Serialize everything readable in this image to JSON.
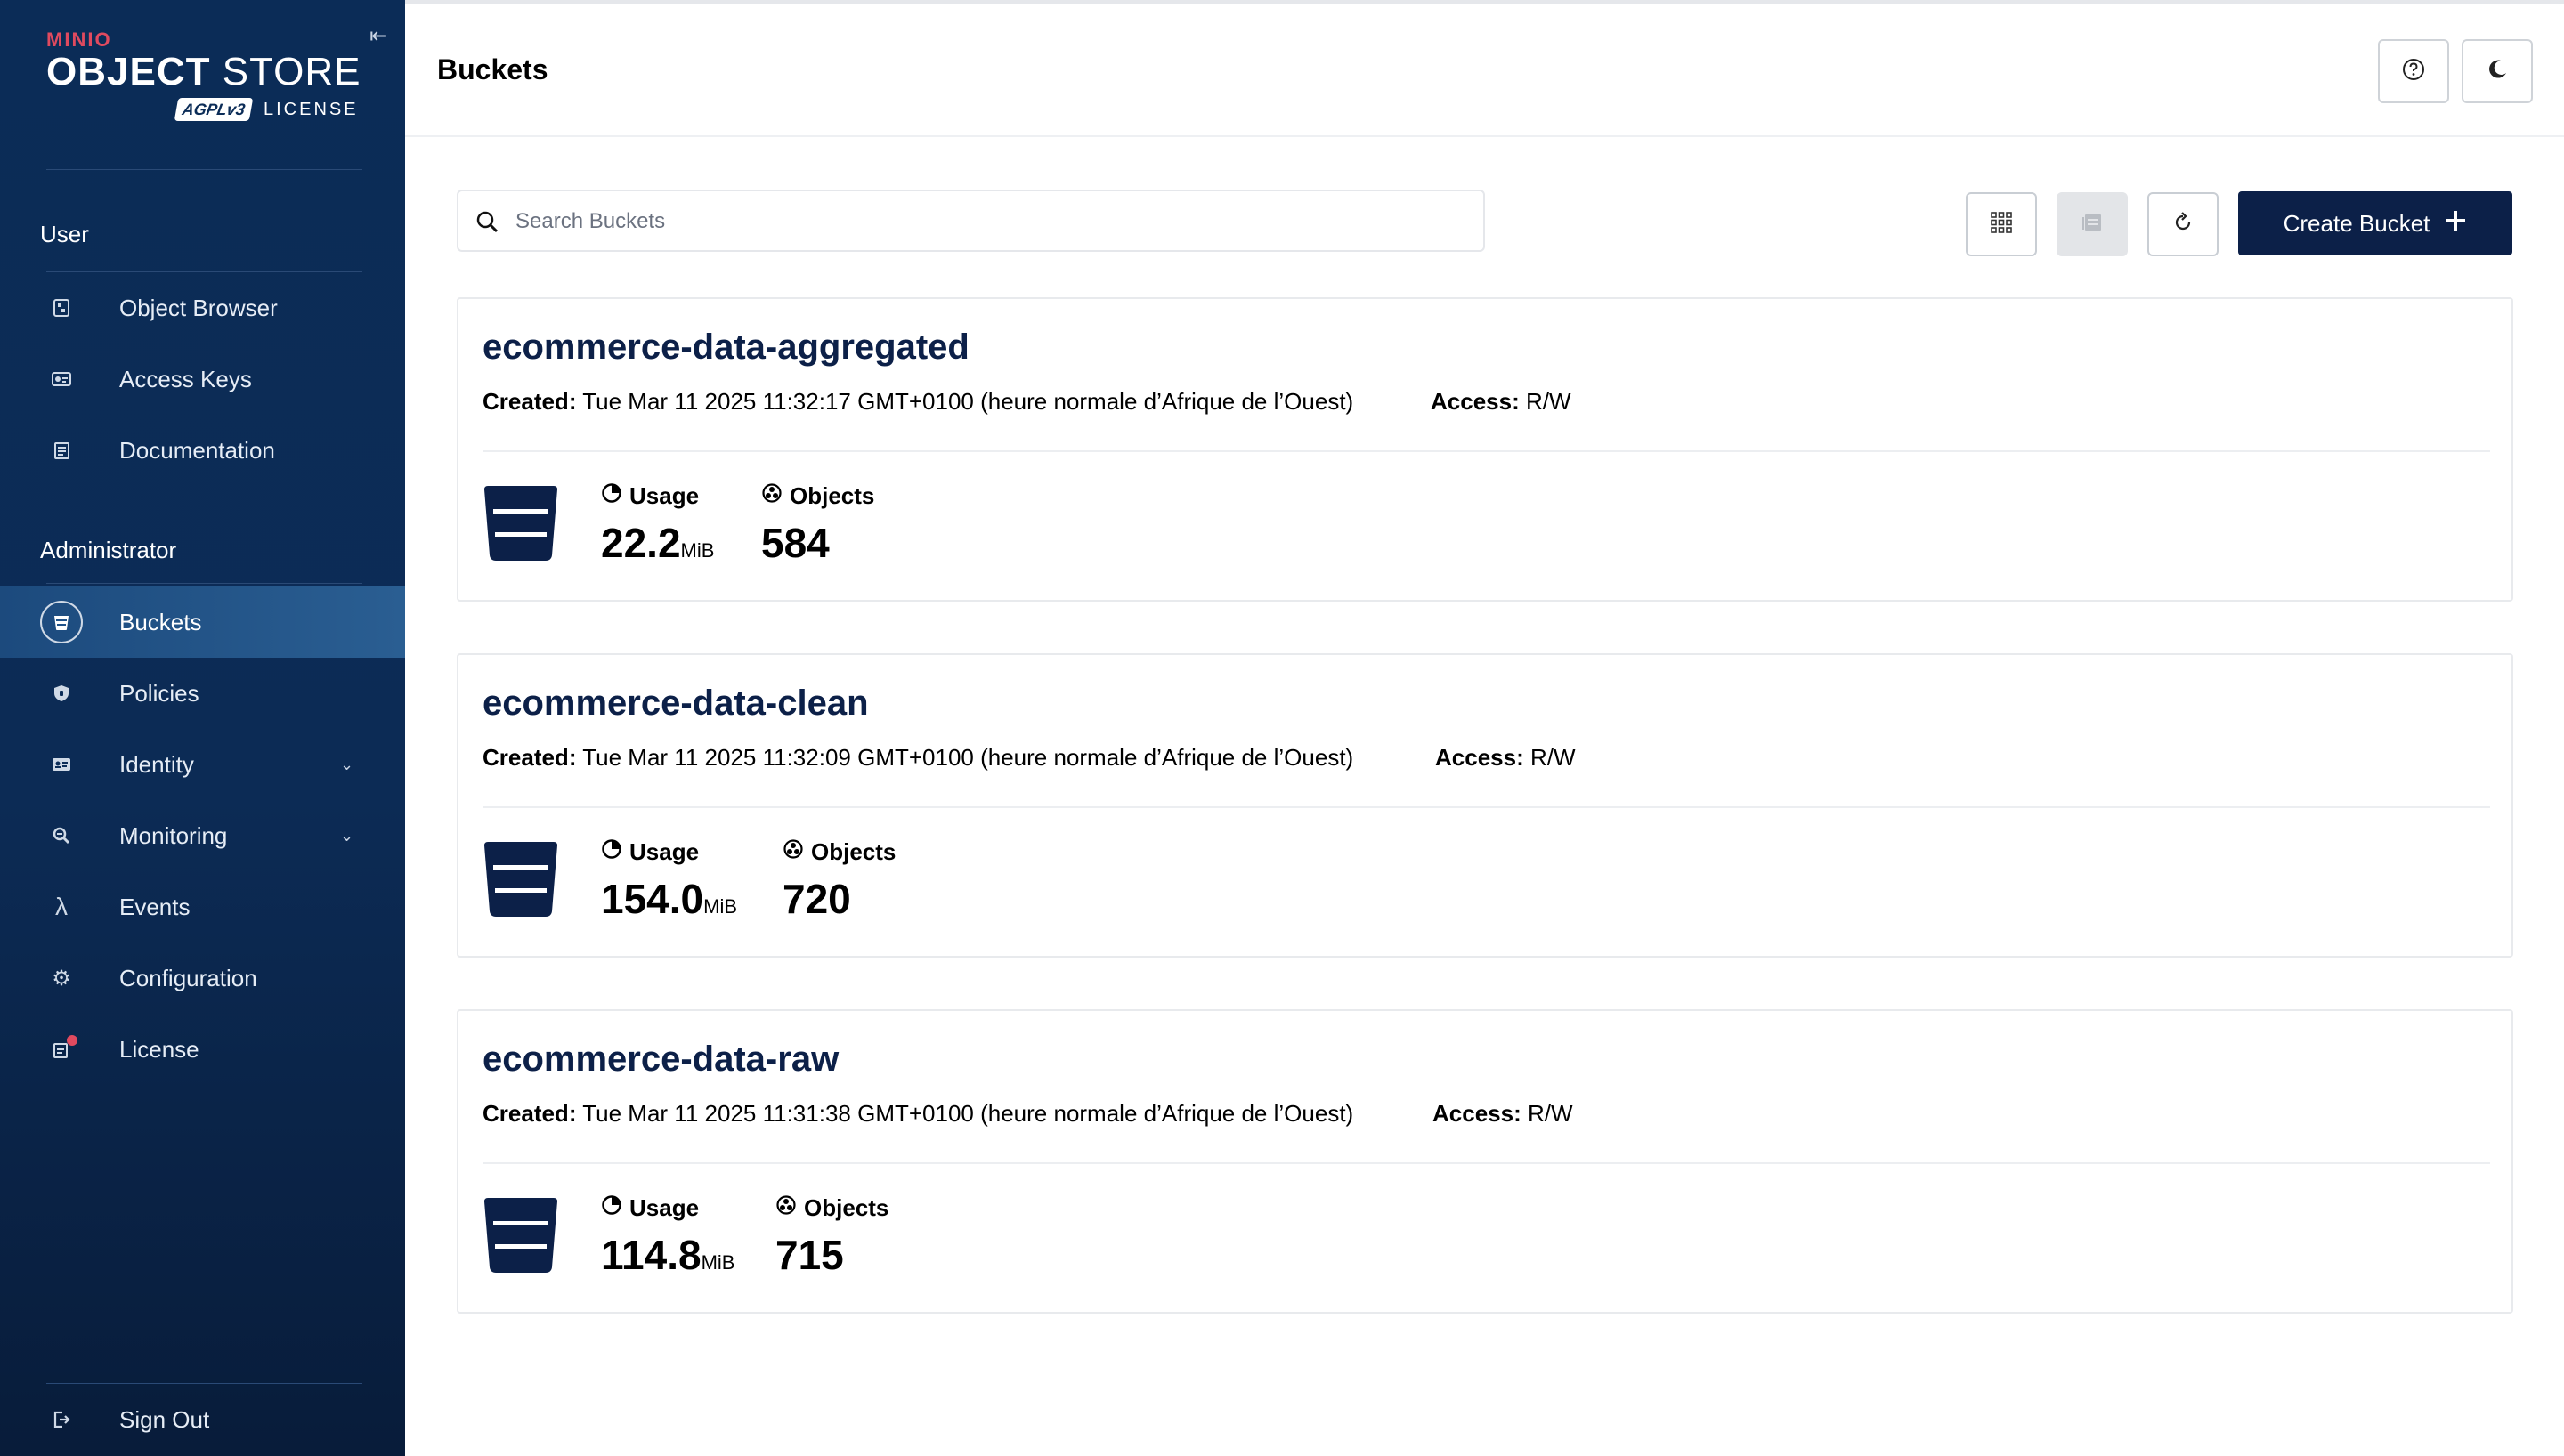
{
  "sidebar": {
    "brand": {
      "minio": "MINIO",
      "object": "OBJECT",
      "store": "STORE",
      "agpl": "AGPLv3",
      "license": "LICENSE"
    },
    "collapse_icon": "collapse-left-icon",
    "user_section": "User",
    "admin_section": "Administrator",
    "items": [
      {
        "label": "Object Browser",
        "icon": "object-browser-icon"
      },
      {
        "label": "Access Keys",
        "icon": "access-keys-icon"
      },
      {
        "label": "Documentation",
        "icon": "documentation-icon"
      },
      {
        "label": "Buckets",
        "icon": "bucket-icon",
        "active": true
      },
      {
        "label": "Policies",
        "icon": "shield-icon"
      },
      {
        "label": "Identity",
        "icon": "identity-icon",
        "expandable": true
      },
      {
        "label": "Monitoring",
        "icon": "monitoring-icon",
        "expandable": true
      },
      {
        "label": "Events",
        "icon": "lambda-icon"
      },
      {
        "label": "Configuration",
        "icon": "gear-icon"
      },
      {
        "label": "License",
        "icon": "license-icon",
        "badge": true
      }
    ],
    "sign_out": "Sign Out"
  },
  "header": {
    "title": "Buckets"
  },
  "toolbar": {
    "search_placeholder": "Search Buckets",
    "create_label": "Create Bucket"
  },
  "buckets": [
    {
      "name": "ecommerce-data-aggregated",
      "created_label": "Created:",
      "created": "Tue Mar 11 2025 11:32:17 GMT+0100 (heure normale d’Afrique de l’Ouest)",
      "access_label": "Access:",
      "access": "R/W",
      "usage_label": "Usage",
      "usage": "22.2",
      "usage_unit": "MiB",
      "objects_label": "Objects",
      "objects": "584"
    },
    {
      "name": "ecommerce-data-clean",
      "created_label": "Created:",
      "created": "Tue Mar 11 2025 11:32:09 GMT+0100 (heure normale d’Afrique de l’Ouest)",
      "access_label": "Access:",
      "access": "R/W",
      "usage_label": "Usage",
      "usage": "154.0",
      "usage_unit": "MiB",
      "objects_label": "Objects",
      "objects": "720"
    },
    {
      "name": "ecommerce-data-raw",
      "created_label": "Created:",
      "created": "Tue Mar 11 2025 11:31:38 GMT+0100 (heure normale d’Afrique de l’Ouest)",
      "access_label": "Access:",
      "access": "R/W",
      "usage_label": "Usage",
      "usage": "114.8",
      "usage_unit": "MiB",
      "objects_label": "Objects",
      "objects": "715"
    }
  ],
  "colors": {
    "sidebar": "#0b2c57",
    "accent": "#0c2048",
    "badge": "#e04a5f"
  }
}
